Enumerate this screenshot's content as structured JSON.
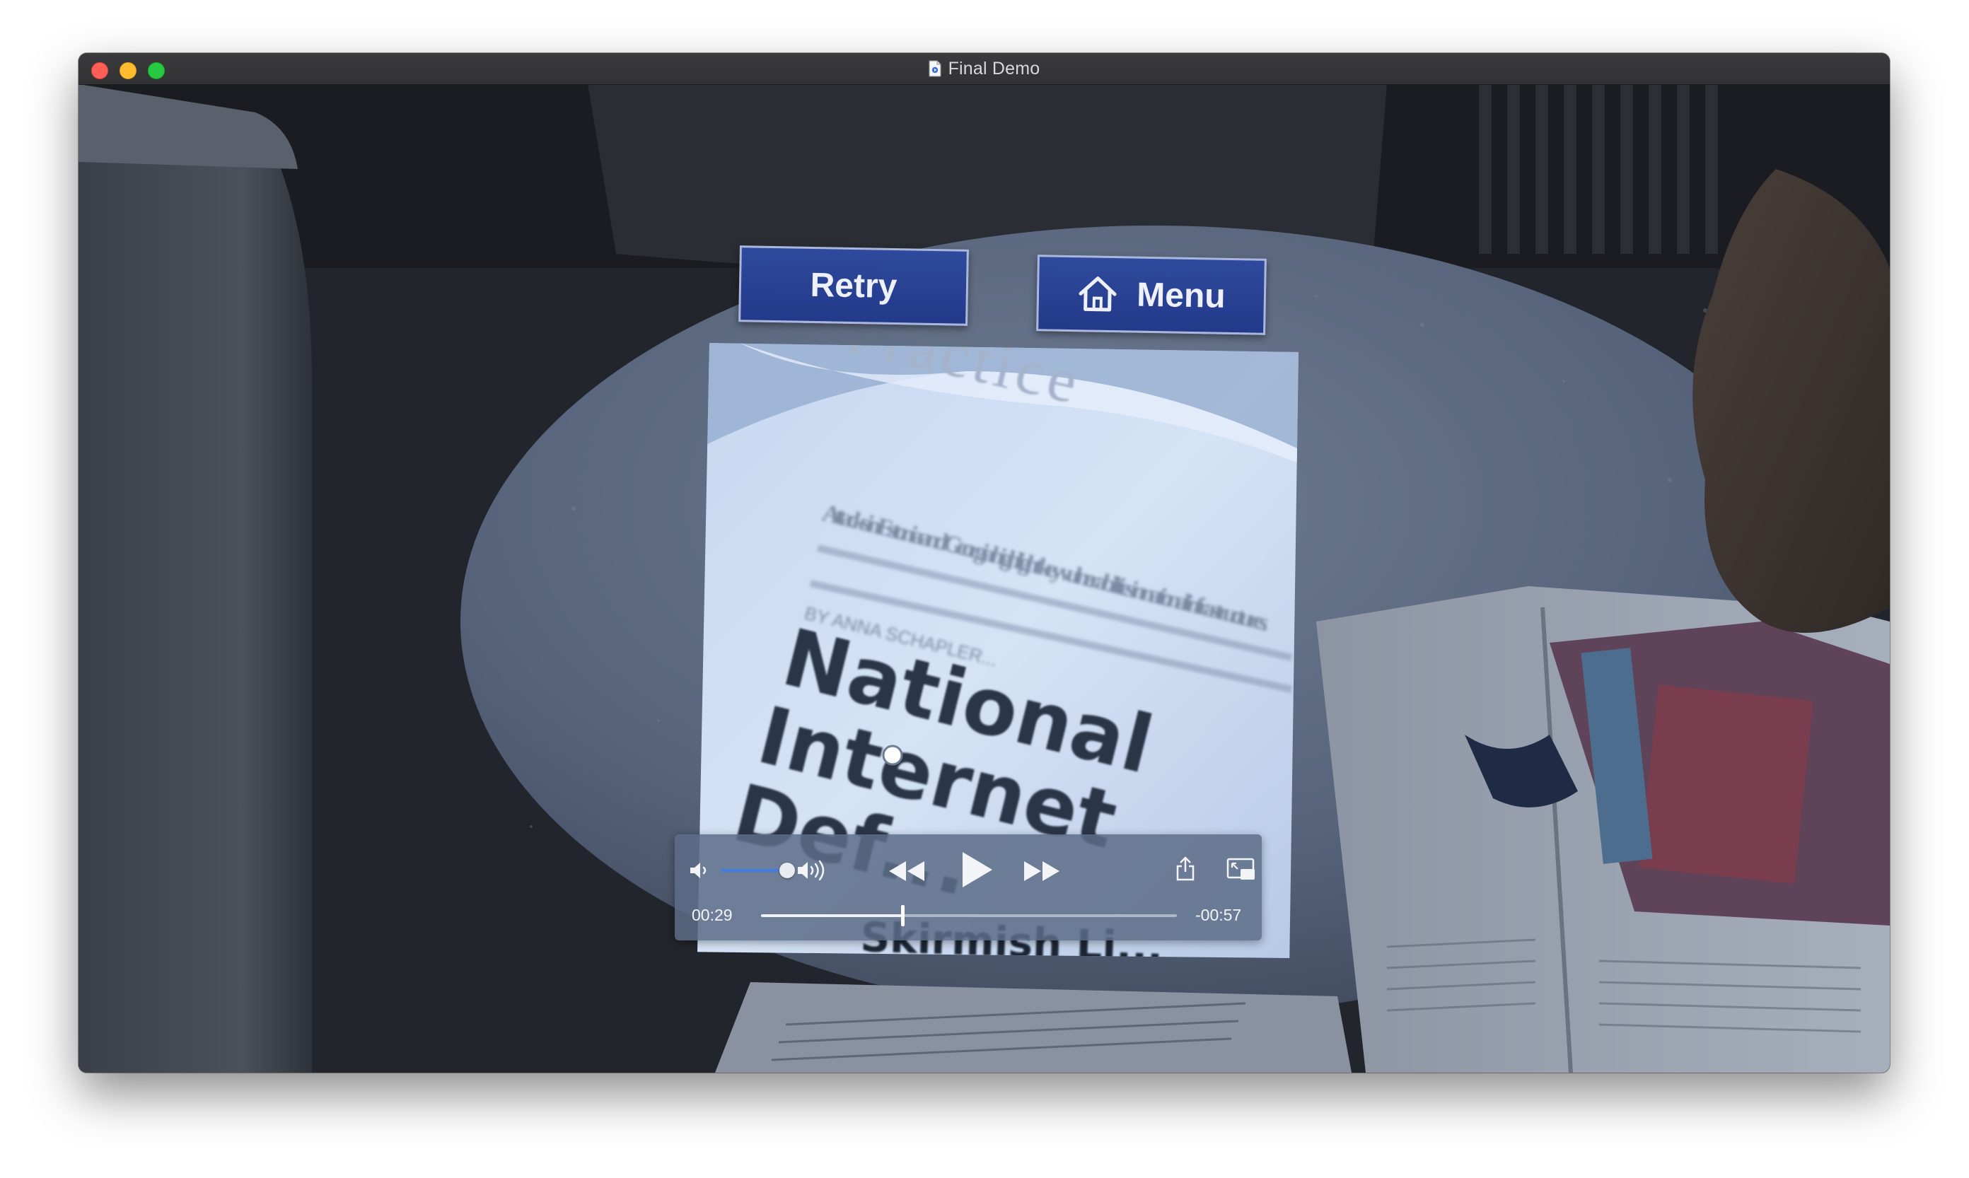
{
  "window": {
    "title": "Final Demo"
  },
  "ar_buttons": {
    "retry_label": "Retry",
    "menu_label": "Menu"
  },
  "document_text": {
    "heading": "Practice",
    "headline_1": "National",
    "headline_2": "Internet",
    "headline_3": "Def...",
    "subhead": "Attacks in Estonia and Georgia highlight key vulnerabilities in national infrastructures.",
    "byline": "BY ANNA SCHAPLER...",
    "bottom": "Skirmish Li..."
  },
  "player": {
    "elapsed": "00:29",
    "remaining": "-00:57",
    "progress_fraction": 0.34,
    "volume_fraction": 0.8
  },
  "colors": {
    "button_blue": "#2b439a",
    "controls_bg": "#5c6c87",
    "accent_blue": "#3e7de5"
  }
}
